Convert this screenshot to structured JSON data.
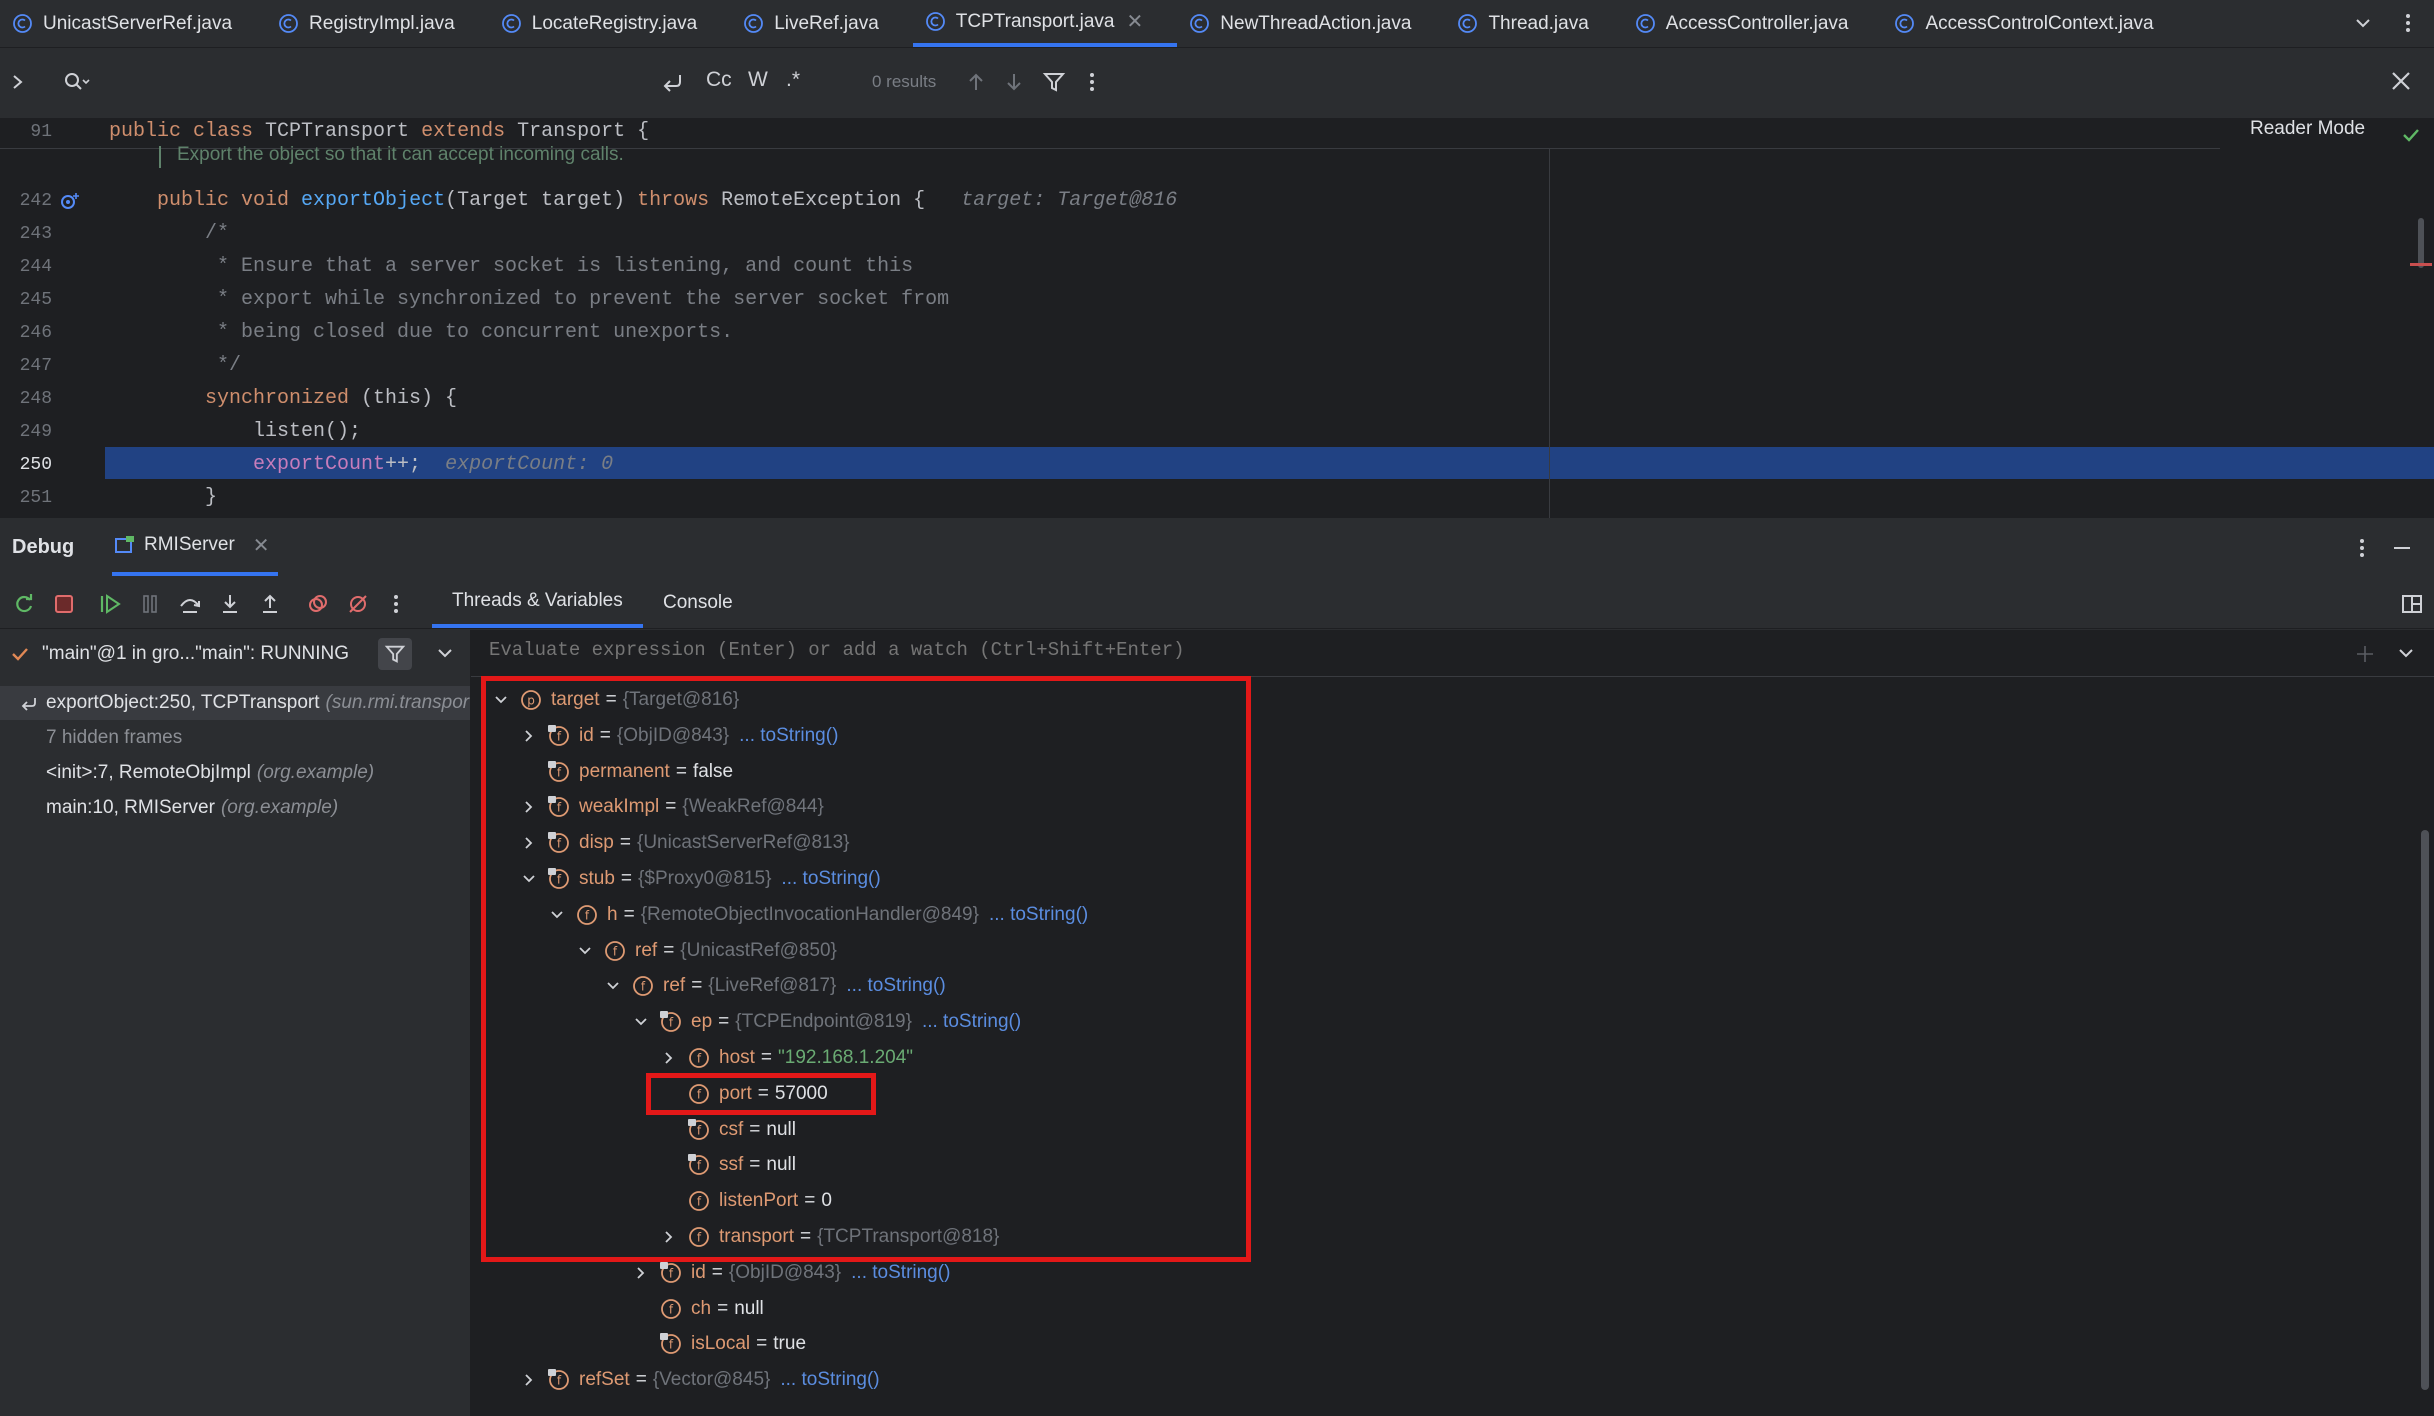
{
  "tabs": [
    {
      "label": "UnicastServerRef.java",
      "active": false
    },
    {
      "label": "RegistryImpl.java",
      "active": false
    },
    {
      "label": "LocateRegistry.java",
      "active": false
    },
    {
      "label": "LiveRef.java",
      "active": false
    },
    {
      "label": "TCPTransport.java",
      "active": true
    },
    {
      "label": "NewThreadAction.java",
      "active": false
    },
    {
      "label": "Thread.java",
      "active": false
    },
    {
      "label": "AccessController.java",
      "active": false
    },
    {
      "label": "AccessControlContext.java",
      "active": false
    }
  ],
  "find": {
    "results": "0 results",
    "case_label": "Cc",
    "word_label": "W",
    "regex_label": ".*"
  },
  "editor": {
    "reader_mode": "Reader Mode",
    "sticky": {
      "line": "91",
      "kw1": "public class",
      "name": " TCPTransport ",
      "kw2": "extends",
      "rest": " Transport {"
    },
    "doc_comment": "Export the object so that it can accept incoming calls.",
    "lines": [
      {
        "num": "242",
        "kw1": "public void",
        "fn": "exportObject",
        "args": "(Target target) ",
        "kw2": "throws",
        "rest": " RemoteException {",
        "hint": "target: Target@816"
      },
      {
        "num": "243",
        "text": "/*"
      },
      {
        "num": "244",
        "text": " * Ensure that a server socket is listening, and count this"
      },
      {
        "num": "245",
        "text": " * export while synchronized to prevent the server socket from"
      },
      {
        "num": "246",
        "text": " * being closed due to concurrent unexports."
      },
      {
        "num": "247",
        "text": " */"
      },
      {
        "num": "248",
        "kw": "synchronized",
        "rest": " (this) {"
      },
      {
        "num": "249",
        "text": "listen();"
      },
      {
        "num": "250",
        "field": "exportCount",
        "rest": "++;",
        "hint": "exportCount: 0"
      },
      {
        "num": "251",
        "text": "}"
      }
    ]
  },
  "debug": {
    "title": "Debug",
    "config_tab": "RMIServer",
    "subtabs": {
      "threads": "Threads & Variables",
      "console": "Console"
    },
    "thread": "\"main\"@1 in gro...\"main\": RUNNING",
    "frames": [
      {
        "method": "exportObject:250, TCPTransport",
        "pkg": "(sun.rmi.transport.tcp)"
      },
      {
        "method": "7 hidden frames",
        "pkg": ""
      },
      {
        "method": "<init>:7, RemoteObjImpl",
        "pkg": "(org.example)"
      },
      {
        "method": "main:10, RMIServer",
        "pkg": "(org.example)"
      }
    ],
    "watch_placeholder": "Evaluate expression (Enter) or add a watch (Ctrl+Shift+Enter)",
    "variables": [
      {
        "name": "target",
        "val": "{Target@816}",
        "kind": "type",
        "icon": "p",
        "depth": 0,
        "arrow": "down"
      },
      {
        "name": "id",
        "val": "{ObjID@843}",
        "kind": "type",
        "link": "... toString()",
        "icon": "f-lock",
        "depth": 1,
        "arrow": "right"
      },
      {
        "name": "permanent",
        "val": "false",
        "kind": "plain",
        "icon": "f-lock",
        "depth": 1,
        "arrow": "none"
      },
      {
        "name": "weakImpl",
        "val": "{WeakRef@844}",
        "kind": "type",
        "icon": "f-lock",
        "depth": 1,
        "arrow": "right"
      },
      {
        "name": "disp",
        "val": "{UnicastServerRef@813}",
        "kind": "type",
        "icon": "f-lock",
        "depth": 1,
        "arrow": "right"
      },
      {
        "name": "stub",
        "val": "{$Proxy0@815}",
        "kind": "type",
        "link": "... toString()",
        "icon": "f-lock",
        "depth": 1,
        "arrow": "down"
      },
      {
        "name": "h",
        "val": "{RemoteObjectInvocationHandler@849}",
        "kind": "type",
        "link": "... toString()",
        "icon": "f",
        "depth": 2,
        "arrow": "down"
      },
      {
        "name": "ref",
        "val": "{UnicastRef@850}",
        "kind": "type",
        "icon": "f",
        "depth": 3,
        "arrow": "down"
      },
      {
        "name": "ref",
        "val": "{LiveRef@817}",
        "kind": "type",
        "link": "... toString()",
        "icon": "f",
        "depth": 4,
        "arrow": "down"
      },
      {
        "name": "ep",
        "val": "{TCPEndpoint@819}",
        "kind": "type",
        "link": "... toString()",
        "icon": "f-lock",
        "depth": 5,
        "arrow": "down"
      },
      {
        "name": "host",
        "val": "\"192.168.1.204\"",
        "kind": "str",
        "icon": "f",
        "depth": 6,
        "arrow": "right"
      },
      {
        "name": "port",
        "val": "57000",
        "kind": "plain",
        "icon": "f",
        "depth": 6,
        "arrow": "none"
      },
      {
        "name": "csf",
        "val": "null",
        "kind": "plain",
        "icon": "f-lock",
        "depth": 6,
        "arrow": "none"
      },
      {
        "name": "ssf",
        "val": "null",
        "kind": "plain",
        "icon": "f-lock",
        "depth": 6,
        "arrow": "none"
      },
      {
        "name": "listenPort",
        "val": "0",
        "kind": "plain",
        "icon": "f",
        "depth": 6,
        "arrow": "none"
      },
      {
        "name": "transport",
        "val": "{TCPTransport@818}",
        "kind": "type",
        "icon": "f",
        "depth": 6,
        "arrow": "right"
      },
      {
        "name": "id",
        "val": "{ObjID@843}",
        "kind": "type",
        "link": "... toString()",
        "icon": "f-lock",
        "depth": 5,
        "arrow": "right"
      },
      {
        "name": "ch",
        "val": "null",
        "kind": "plain",
        "icon": "f",
        "depth": 5,
        "arrow": "none"
      },
      {
        "name": "isLocal",
        "val": "true",
        "kind": "plain",
        "icon": "f-lock",
        "depth": 5,
        "arrow": "none"
      },
      {
        "name": "refSet",
        "val": "{Vector@845}",
        "kind": "type",
        "link": "... toString()",
        "icon": "f-lock",
        "depth": 1,
        "arrow": "right"
      }
    ]
  },
  "colors": {
    "accent": "#3574f0",
    "highlight_box": "#e31818",
    "execution_line": "#214283",
    "keyword": "#cf8e6d",
    "function": "#56a8f5"
  }
}
